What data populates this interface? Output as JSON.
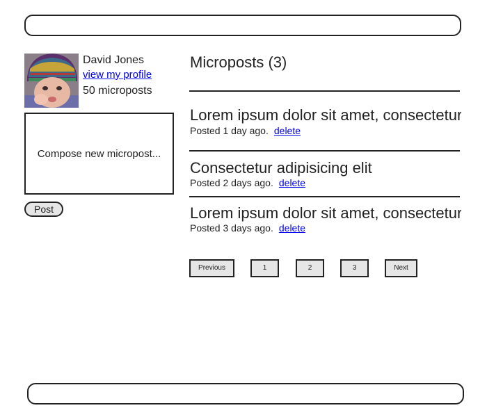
{
  "user": {
    "name": "David Jones",
    "profile_link": "view my profile",
    "micropost_count": "50 microposts"
  },
  "compose": {
    "placeholder": "Compose new micropost...",
    "post_label": "Post"
  },
  "feed": {
    "title": "Microposts (3)",
    "posts": [
      {
        "content": "Lorem ipsum dolor sit amet, consectetur",
        "meta": "Posted 1 day ago.",
        "delete_label": "delete"
      },
      {
        "content": "Consectetur adipisicing elit",
        "meta": "Posted 2 days ago.",
        "delete_label": "delete"
      },
      {
        "content": "Lorem ipsum dolor sit amet, consectetur",
        "meta": "Posted 3 days ago.",
        "delete_label": "delete"
      }
    ]
  },
  "pagination": {
    "previous": "Previous",
    "pages": [
      "1",
      "2",
      "3"
    ],
    "next": "Next"
  }
}
